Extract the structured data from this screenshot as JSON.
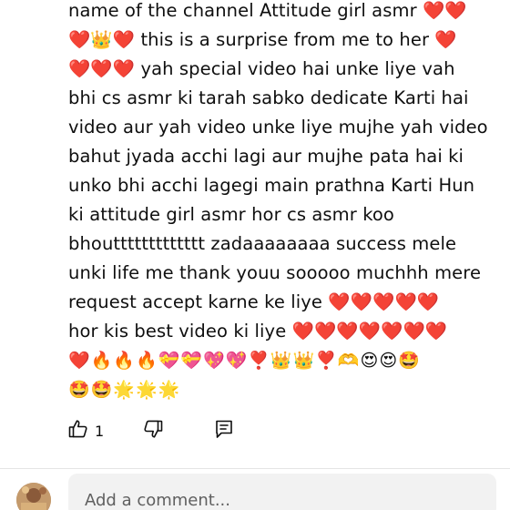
{
  "comment": {
    "lines": [
      "name of the channel Attitude girl asmr ❤️❤️",
      "❤️👑❤️ this is a surprise from me to her ❤️",
      "❤️❤️❤️ yah special video hai unke liye vah",
      "bhi cs asmr  ki tarah sabko dedicate Karti hai",
      "video aur yah video unke liye mujhe yah video",
      "bahut jyada acchi lagi aur mujhe pata hai ki",
      "unko bhi acchi lagegi main prathna Karti Hun",
      "ki attitude girl asmr hor cs asmr koo",
      "bhouttttttttttttt zadaaaaaaaa success mele",
      "unki life me thank youu sooooo muchhh mere",
      "request accept karne ke liye ❤️❤️❤️❤️❤️",
      "hor kis best video ki liye ❤️❤️❤️❤️❤️❤️❤️"
    ],
    "emoji_lines": [
      "❤️🔥🔥🔥💝💝💖💖❣️👑👑❣️🫶😍😍🤩",
      "🤩🤩🌟🌟🌟"
    ]
  },
  "actions": {
    "like_count": "1"
  },
  "composer": {
    "placeholder": "Add a comment..."
  },
  "icons": {
    "like": "thumbs-up-icon",
    "dislike": "thumbs-down-icon",
    "reply": "reply-comment-icon"
  },
  "colors": {
    "text": "#0f0f0f",
    "icon": "#0f0f0f",
    "placeholder": "#606060",
    "input_bg": "#f2f2f2",
    "divider": "#e5e5e5"
  }
}
